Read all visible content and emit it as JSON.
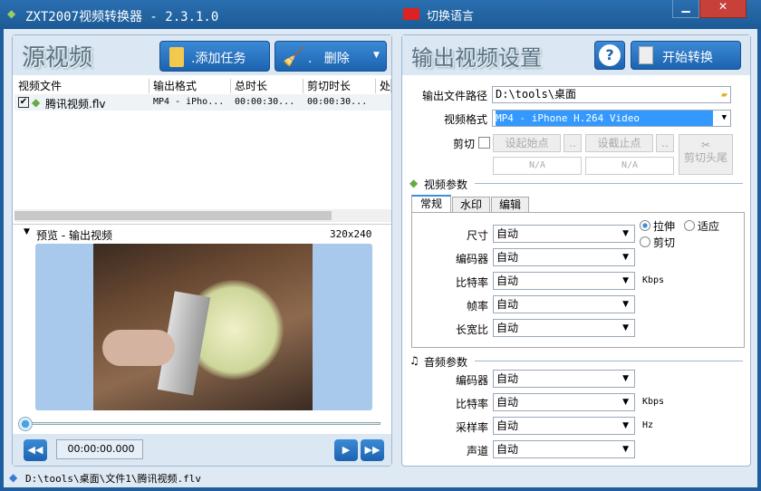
{
  "window": {
    "title": "ZXT2007视频转换器 - 2.3.1.0",
    "language_button": "切换语言"
  },
  "left": {
    "title": "源视频",
    "add_task": ".添加任务",
    "delete": ".   删除",
    "columns": [
      "视频文件",
      "输出格式",
      "总时长",
      "剪切时长",
      "处"
    ],
    "rows": [
      {
        "checked": true,
        "file": "腾讯视频.flv",
        "format": "MP4 - iPho...",
        "total": "00:00:30...",
        "cut": "00:00:30..."
      }
    ],
    "preview_label": "预览 - 输出视频",
    "preview_size": "320x240",
    "time": "00:00:00.000",
    "progress": 0
  },
  "right": {
    "title": "输出视频设置",
    "start": "开始转换",
    "help": "?",
    "path_label": "输出文件路径",
    "path_value": "D:\\tools\\桌面",
    "format_label": "视频格式",
    "format_value": "MP4 - iPhone H.264 Video",
    "cut_label": "剪切",
    "set_start": "设起始点",
    "set_end": "设截止点",
    "more": "..",
    "start_value": "N/A",
    "end_value": "N/A",
    "cut_ends": "剪切头尾",
    "video_params": "视频参数",
    "tabs": [
      "常规",
      "水印",
      "编辑"
    ],
    "video_rows": [
      {
        "label": "尺寸",
        "value": "自动",
        "unit": ""
      },
      {
        "label": "编码器",
        "value": "自动",
        "unit": ""
      },
      {
        "label": "比特率",
        "value": "自动",
        "unit": "Kbps"
      },
      {
        "label": "帧率",
        "value": "自动",
        "unit": ""
      },
      {
        "label": "长宽比",
        "value": "自动",
        "unit": ""
      }
    ],
    "radios": {
      "stretch": "拉伸",
      "fit": "适应",
      "crop": "剪切",
      "selected": "stretch"
    },
    "audio_params": "音频参数",
    "audio_rows": [
      {
        "label": "编码器",
        "value": "自动",
        "unit": ""
      },
      {
        "label": "比特率",
        "value": "自动",
        "unit": "Kbps"
      },
      {
        "label": "采样率",
        "value": "自动",
        "unit": "Hz"
      },
      {
        "label": "声道",
        "value": "自动",
        "unit": ""
      }
    ]
  },
  "status": {
    "path": "D:\\tools\\桌面\\文件1\\腾讯视频.flv"
  }
}
